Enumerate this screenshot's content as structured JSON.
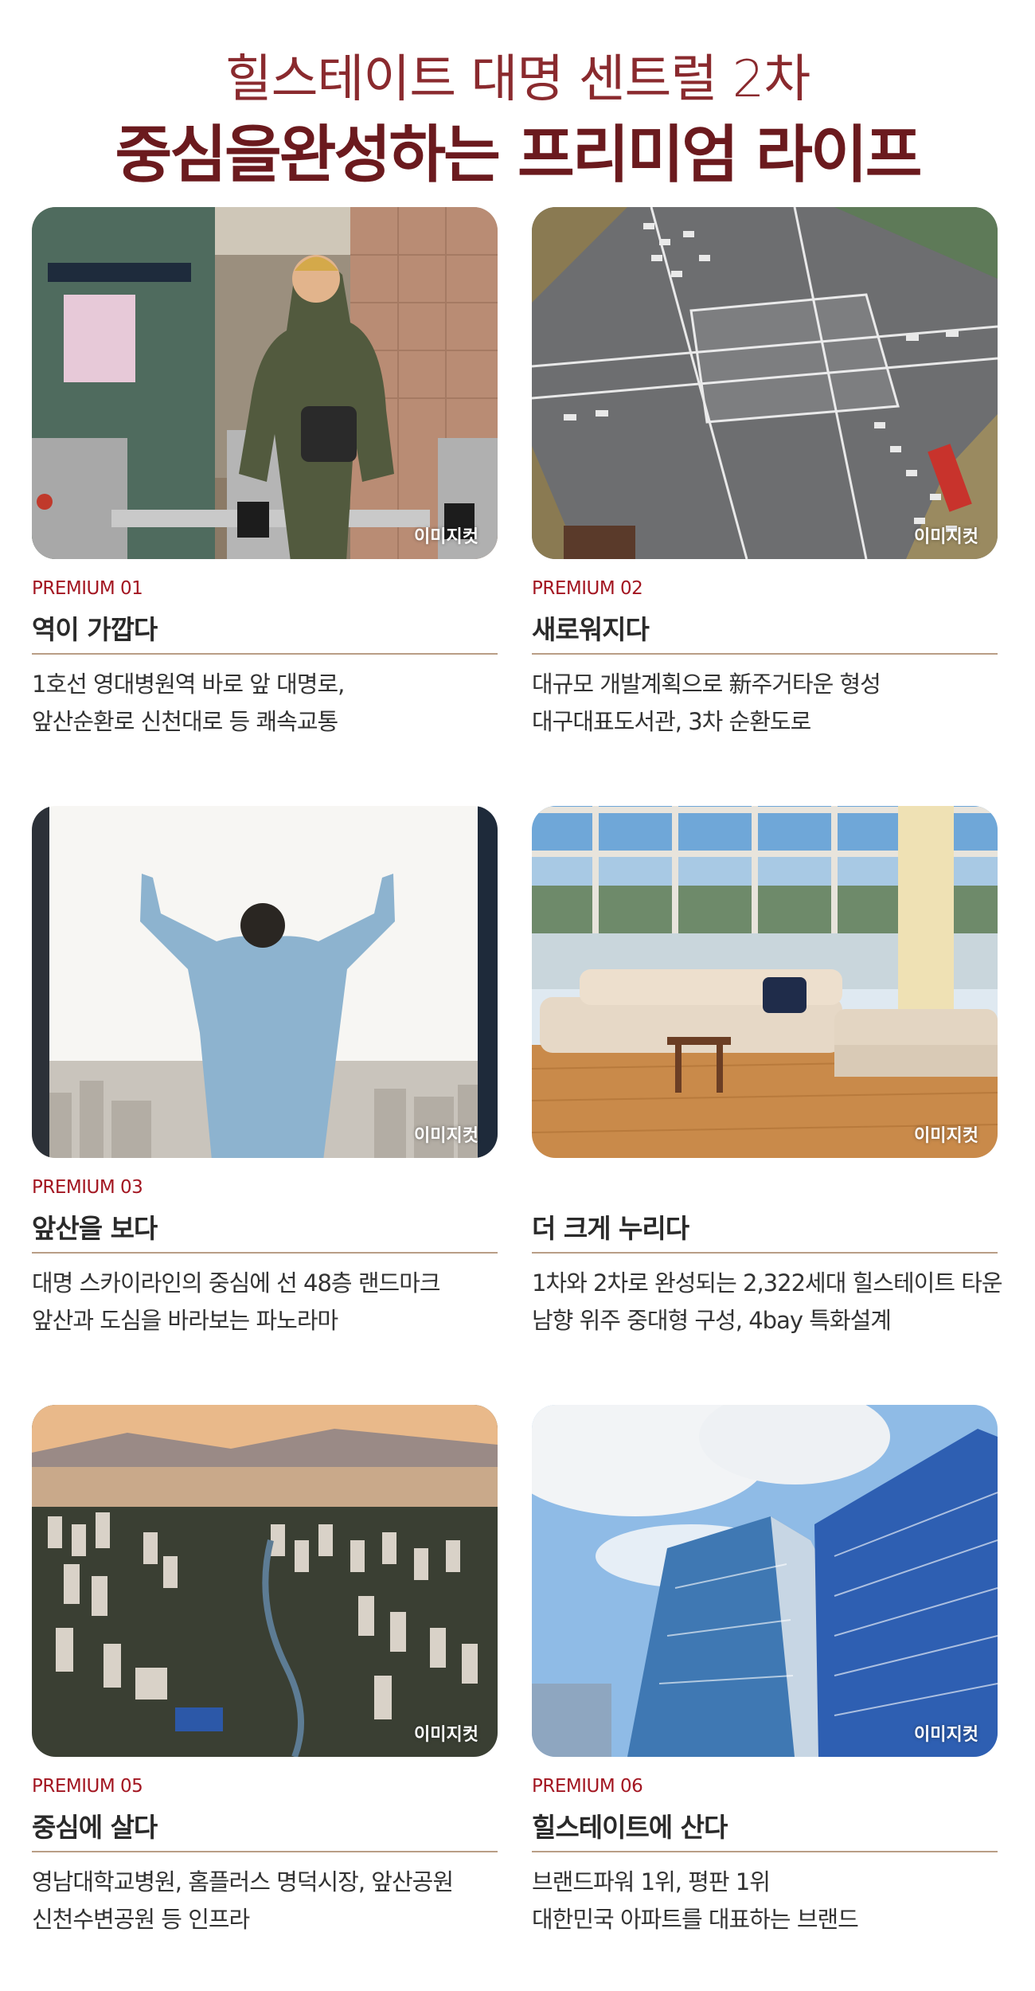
{
  "header": {
    "subtitle": "힐스테이트 대명 센트럴 2차",
    "title": "중심을완성하는 프리미엄 라이프"
  },
  "watermark": "이미지컷",
  "colors": {
    "accent": "#a31621",
    "title": "#6b1a1e",
    "divider": "#b99e86"
  },
  "cards": [
    {
      "premium": "PREMIUM 01",
      "title": "역이 가깝다",
      "desc": [
        "1호선 영대병원역 바로 앞 대명로,",
        "앞산순환로 신천대로 등 쾌속교통"
      ],
      "image": "subway-gate-photo"
    },
    {
      "premium": "PREMIUM 02",
      "title": "새로워지다",
      "desc": [
        "대규모 개발계획으로 新주거타운 형성",
        "대구대표도서관, 3차 순환도로"
      ],
      "image": "intersection-aerial-photo"
    },
    {
      "premium": "PREMIUM 03",
      "title": "앞산을 보다",
      "desc": [
        "대명 스카이라인의 중심에 선 48층 랜드마크",
        "앞산과 도심을 바라보는 파노라마"
      ],
      "image": "man-window-view-photo"
    },
    {
      "premium": "",
      "title": "더 크게 누리다",
      "desc": [
        "1차와 2차로 완성되는 2,322세대 힐스테이트 타운",
        "남향 위주 중대형 구성, 4bay 특화설계"
      ],
      "image": "living-room-photo"
    },
    {
      "premium": "PREMIUM 05",
      "title": "중심에 살다",
      "desc": [
        "영남대학교병원, 홈플러스 명덕시장, 앞산공원",
        "신천수변공원 등 인프라"
      ],
      "image": "city-aerial-photo"
    },
    {
      "premium": "PREMIUM 06",
      "title": "힐스테이트에 산다",
      "desc": [
        "브랜드파워 1위, 평판 1위",
        "대한민국 아파트를 대표하는 브랜드"
      ],
      "image": "glass-towers-photo"
    }
  ]
}
